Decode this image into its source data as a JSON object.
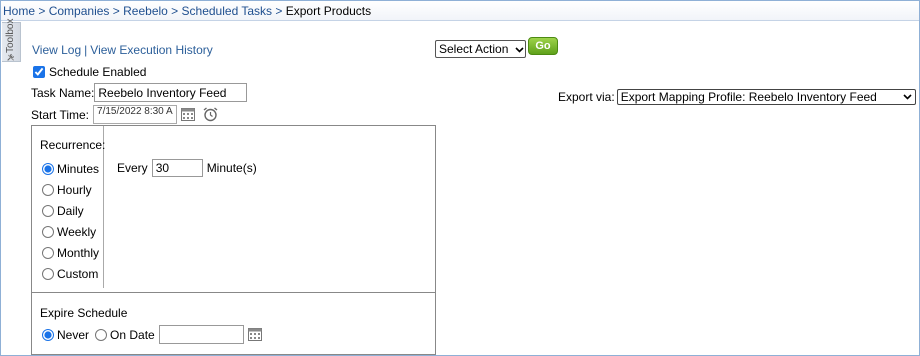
{
  "breadcrumb": {
    "home": "Home",
    "companies": "Companies",
    "reebelo": "Reebelo",
    "scheduled_tasks": "Scheduled Tasks",
    "current": "Export Products",
    "separator": ">"
  },
  "toolbox": {
    "label": "Toolbox",
    "icon": "tools-icon"
  },
  "links": {
    "view_log": "View Log",
    "divider": "|",
    "view_history": "View Execution History"
  },
  "schedule": {
    "enabled_label": "Schedule Enabled",
    "enabled": true
  },
  "task": {
    "label": "Task Name:",
    "value": "Reebelo Inventory Feed"
  },
  "start": {
    "label": "Start Time:",
    "value": "7/15/2022 8:30 A",
    "calendar_icon": "calendar-icon",
    "alarm_icon": "alarm-clock-icon"
  },
  "actions": {
    "select_label": "Select Action",
    "go_label": "Go"
  },
  "export": {
    "label": "Export via:",
    "value": "Export Mapping Profile: Reebelo Inventory Feed"
  },
  "recurrence": {
    "label": "Recurrence:",
    "options": [
      "Minutes",
      "Hourly",
      "Daily",
      "Weekly",
      "Monthly",
      "Custom"
    ],
    "selected": "Minutes",
    "every_label": "Every",
    "every_value": "30",
    "unit_label": "Minute(s)"
  },
  "expire": {
    "label": "Expire Schedule",
    "never_label": "Never",
    "on_date_label": "On Date",
    "selected": "Never",
    "date_value": ""
  },
  "colors": {
    "link": "#2c5f9a",
    "go_button": "#5fa11a",
    "border": "#8fb0d6"
  }
}
